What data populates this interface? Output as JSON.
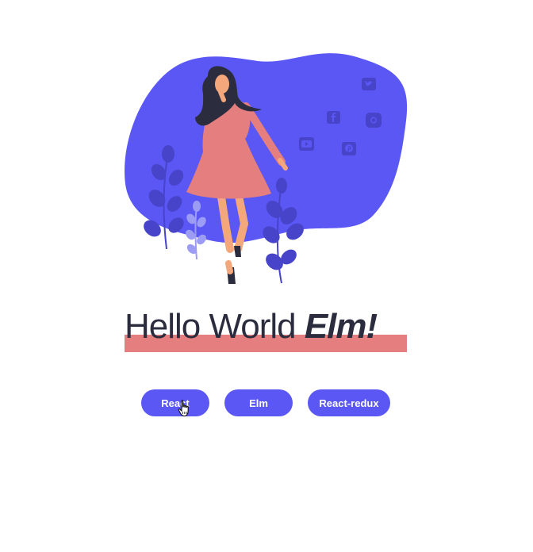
{
  "hero": {
    "heading_main": "Hello World ",
    "heading_emphasis": "Elm!"
  },
  "colors": {
    "accent": "#5a57f5",
    "highlight": "#e57e7e",
    "text": "#2b2d3f"
  },
  "buttons": {
    "react": "React",
    "elm": "Elm",
    "react_redux": "React-redux"
  },
  "social_icons": [
    "twitter-icon",
    "facebook-icon",
    "instagram-icon",
    "youtube-icon",
    "pinterest-icon"
  ]
}
